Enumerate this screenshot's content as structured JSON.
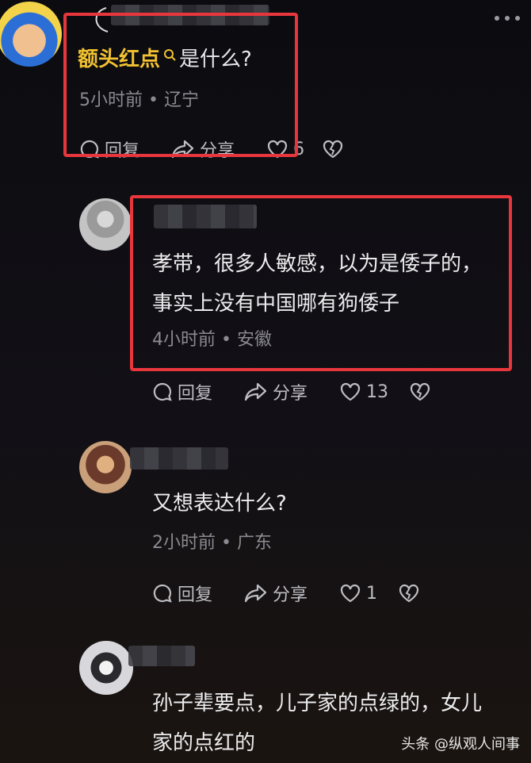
{
  "comment1": {
    "keyword": "额头红点",
    "question": "是什么?",
    "meta": "5小时前 • 辽宁",
    "reply_label": "回复",
    "share_label": "分享",
    "likes": "6"
  },
  "comment2": {
    "line1": "孝带，很多人敏感，以为是倭子的，",
    "line2": "事实上没有中国哪有狗倭子",
    "meta": "4小时前 • 安徽",
    "reply_label": "回复",
    "share_label": "分享",
    "likes": "13"
  },
  "comment3": {
    "text": "又想表达什么?",
    "meta": "2小时前 • 广东",
    "reply_label": "回复",
    "share_label": "分享",
    "likes": "1"
  },
  "comment4": {
    "line1": "孙子辈要点，儿子家的点绿的，女儿",
    "line2": "家的点红的"
  },
  "watermark": "头条 @纵观人间事",
  "icons": [
    "more-icon",
    "search-icon",
    "reply-icon",
    "share-icon",
    "heart-icon",
    "broken-heart-icon"
  ]
}
